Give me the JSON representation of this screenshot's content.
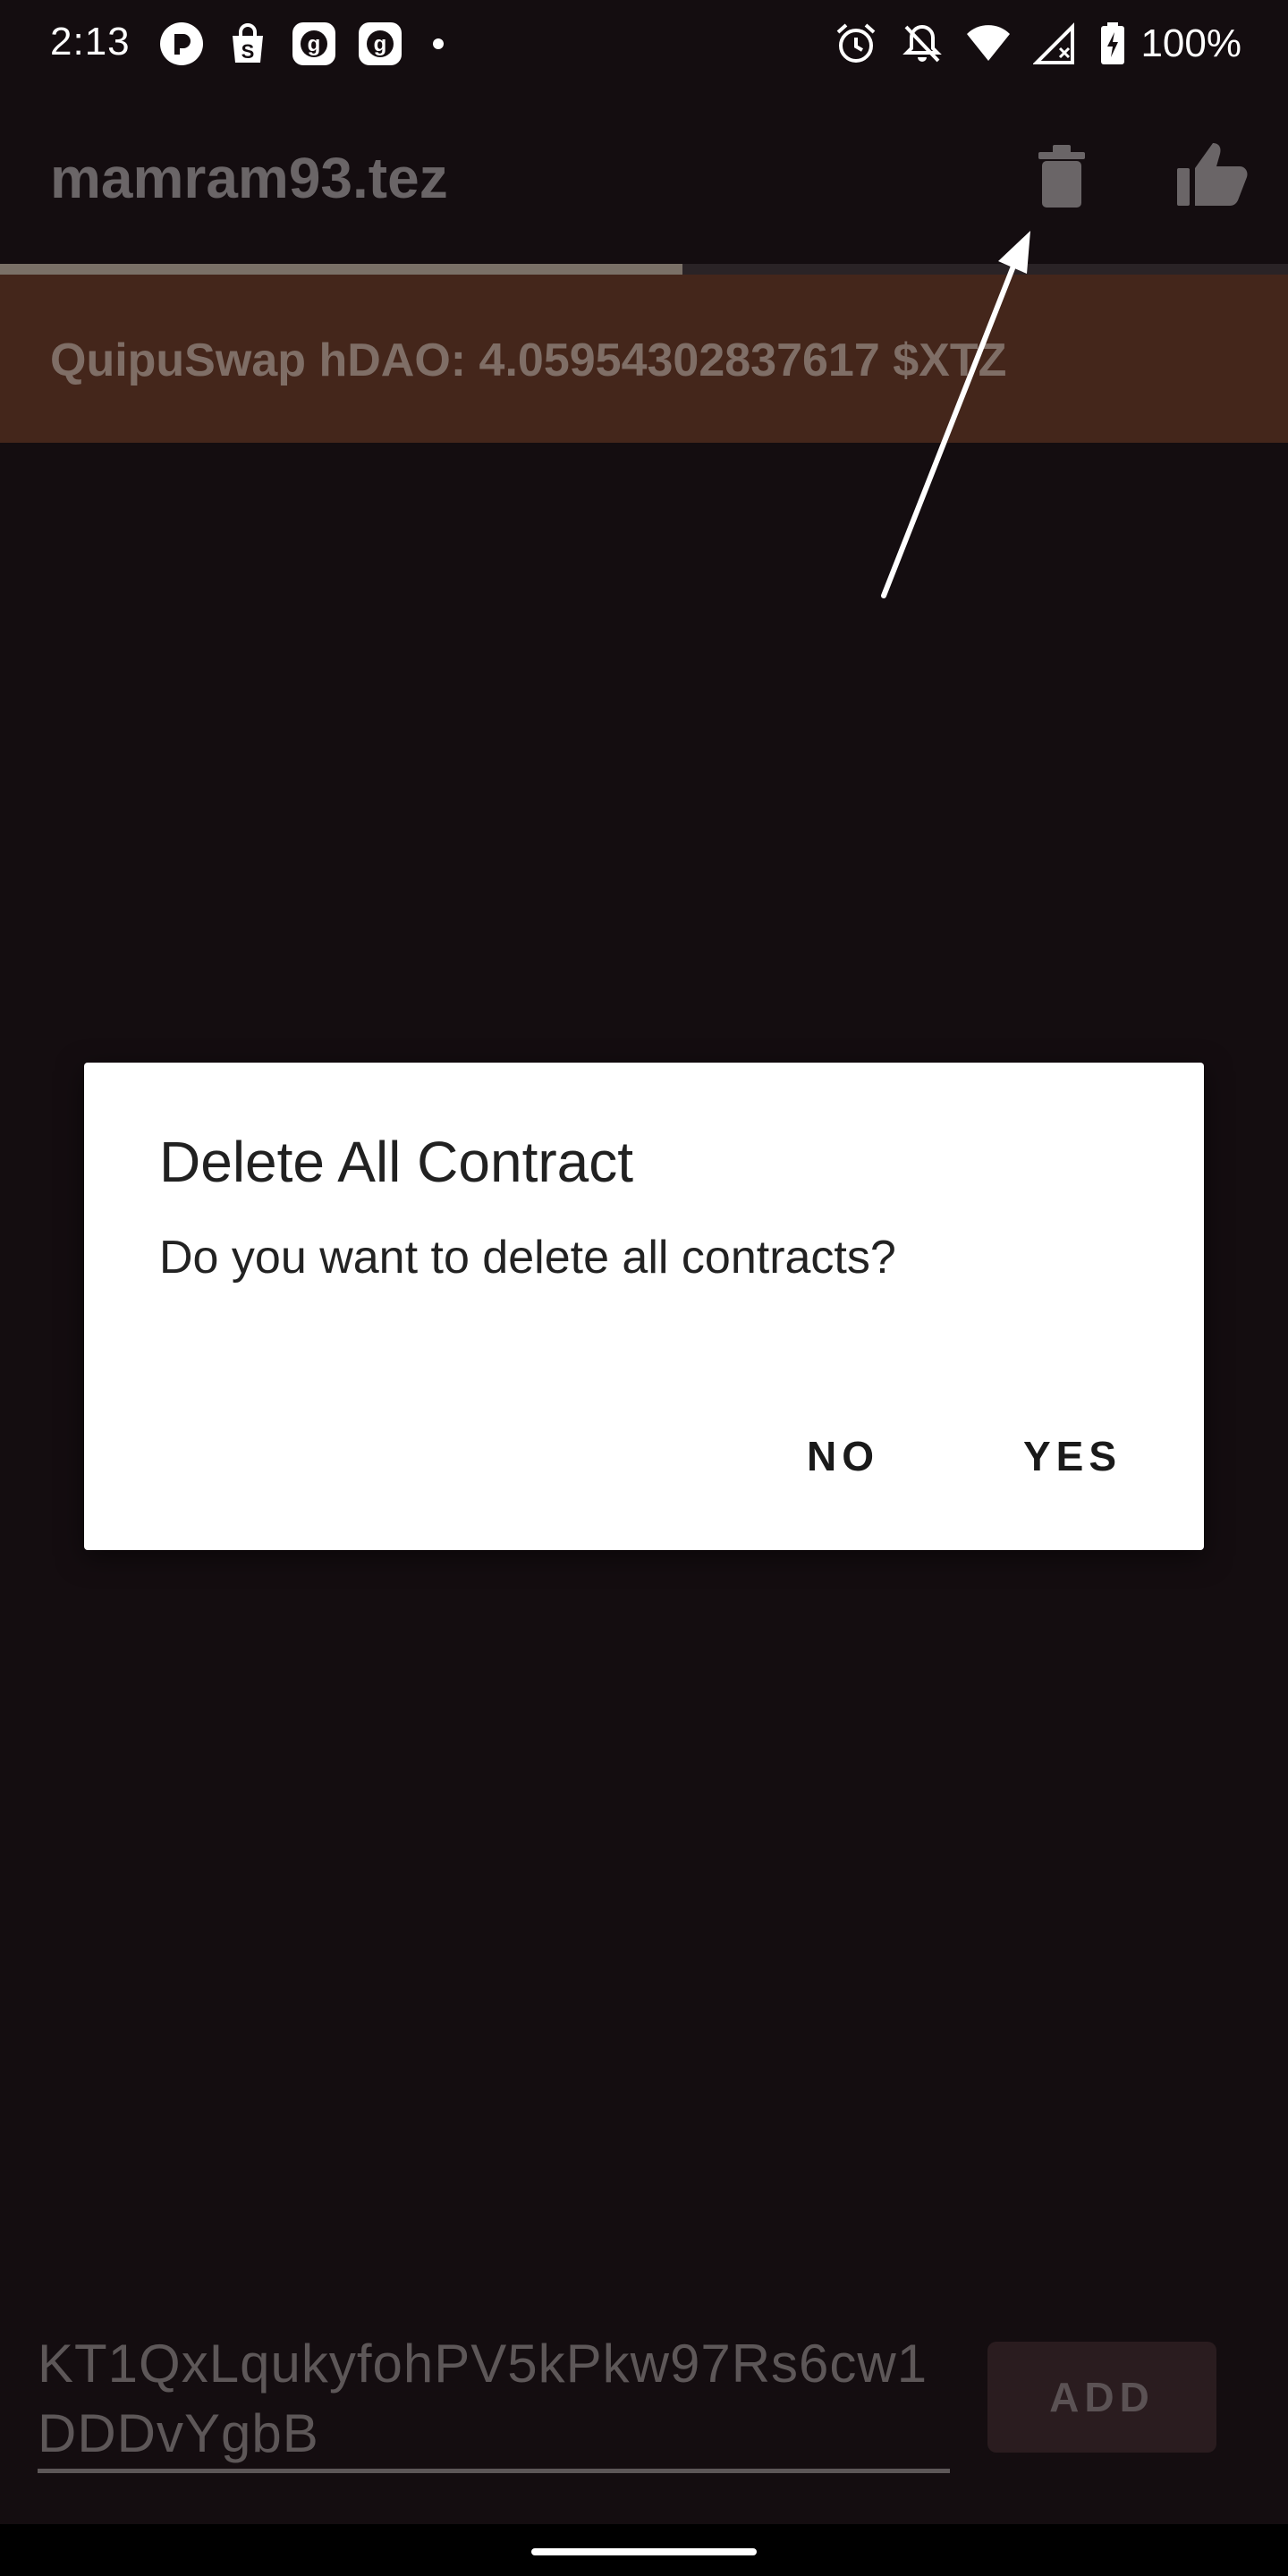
{
  "status_bar": {
    "time": "2:13",
    "battery": "100%",
    "notification_icons": [
      "pocket-icon",
      "shopping-icon",
      "g-icon",
      "g-icon"
    ],
    "system_icons": [
      "alarm-icon",
      "notifications-off-icon",
      "wifi-icon",
      "signal-icon",
      "battery-charging-icon"
    ]
  },
  "app_bar": {
    "title": "mamram93.tez",
    "actions": [
      "delete-icon",
      "thumbs-up-icon"
    ],
    "progress_fraction": 0.53
  },
  "banner": {
    "text": "QuipuSwap hDAO: 4.05954302837617 $XTZ"
  },
  "dialog": {
    "title": "Delete All Contract",
    "message": "Do you want to delete all contracts?",
    "buttons": {
      "no": "NO",
      "yes": "YES"
    }
  },
  "contract_input": {
    "value": "KT1QxLqukyfohPV5kPkw97Rs6cw1DDDvYgbB"
  },
  "add_button": {
    "label": "ADD"
  },
  "colors": {
    "background": "#140d10",
    "banner": "#44261b",
    "dialog": "#ffffff",
    "annotation_arrow": "#ffffff"
  }
}
